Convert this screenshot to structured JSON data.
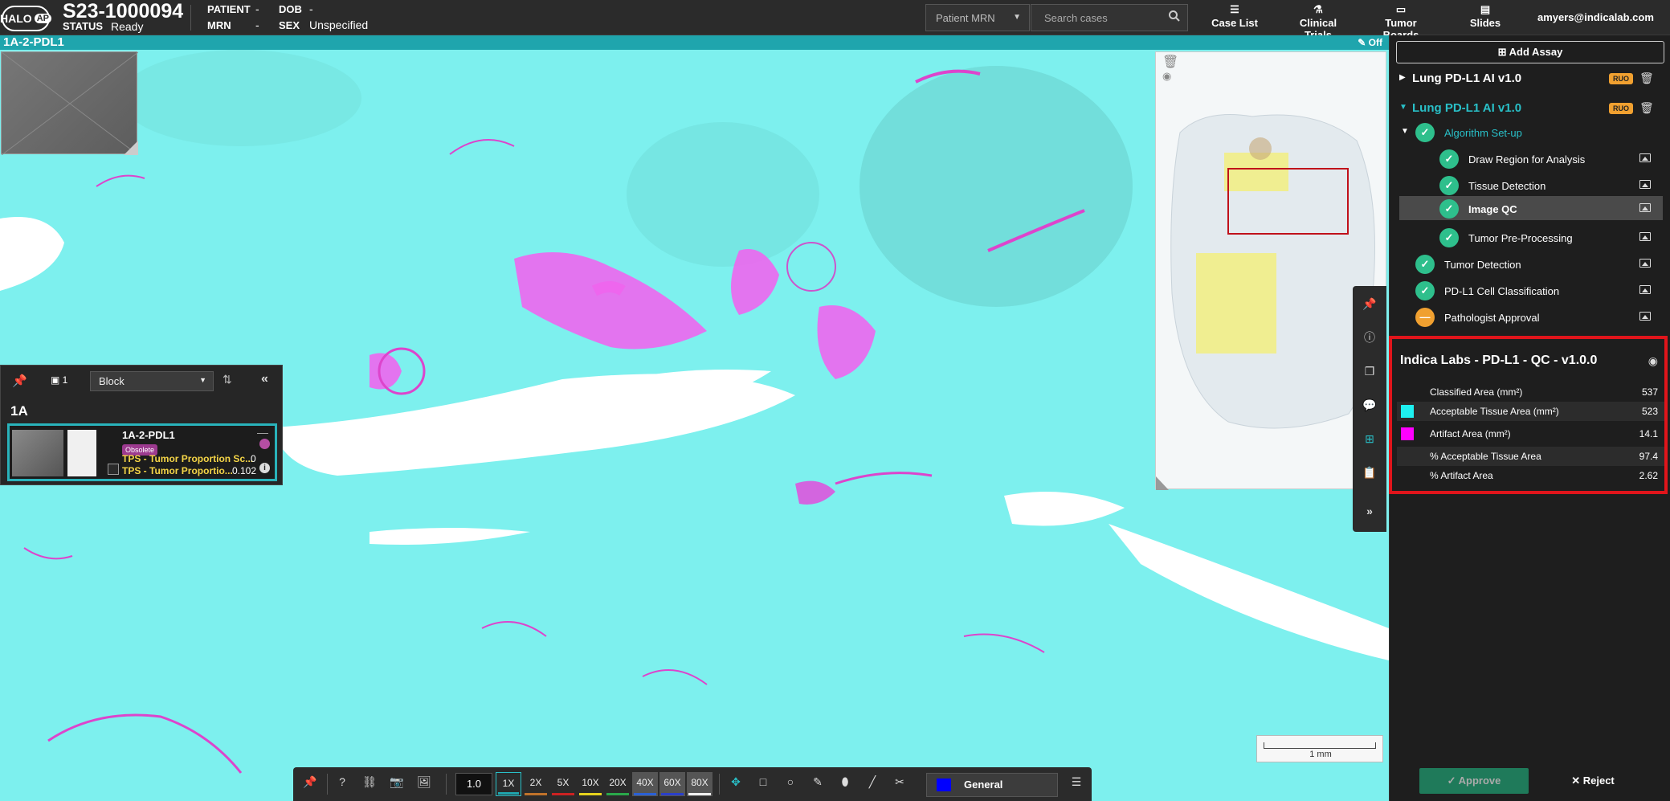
{
  "header": {
    "logo_text": "HALO",
    "logo_sub": "AP",
    "case_id": "S23-1000094",
    "status_label": "STATUS",
    "status_value": "Ready",
    "patient_label": "PATIENT",
    "patient_value": "-",
    "mrn_label": "MRN",
    "mrn_value": "-",
    "dob_label": "DOB",
    "dob_value": "-",
    "sex_label": "SEX",
    "sex_value": "Unspecified",
    "search_scope": "Patient MRN",
    "search_placeholder": "Search cases",
    "nav": [
      {
        "label": "Case List",
        "icon": "list-icon"
      },
      {
        "label": "Clinical Trials",
        "icon": "flask-icon"
      },
      {
        "label": "Tumor Boards",
        "icon": "board-icon"
      },
      {
        "label": "Slides",
        "icon": "slides-icon"
      }
    ],
    "user_email": "amyers@indicalab.com"
  },
  "viewer": {
    "slide_title": "1A-2-PDL1",
    "annotation_toggle": "Off",
    "scale_label": "1 mm"
  },
  "slide_panel": {
    "count": "1",
    "group_by": "Block",
    "group_name": "1A",
    "card": {
      "name": "1A-2-PDL1",
      "badge": "Obsolete",
      "tps1_label": "TPS - Tumor Proportion Sc...",
      "tps1_value": "0",
      "tps2_label": "TPS - Tumor Proportio...",
      "tps2_value": "0.102"
    }
  },
  "toolbar": {
    "zoom_value": "1.0",
    "zoom_levels": [
      {
        "label": "1X",
        "color": "#1fa5ad"
      },
      {
        "label": "2X",
        "color": "#c0722a"
      },
      {
        "label": "5X",
        "color": "#cc2222"
      },
      {
        "label": "10X",
        "color": "#e6d21e"
      },
      {
        "label": "20X",
        "color": "#2aa84a"
      },
      {
        "label": "40X",
        "color": "#2a60d6"
      },
      {
        "label": "60X",
        "color": "#2a3fc9"
      },
      {
        "label": "80X",
        "color": "#eeeeee"
      }
    ],
    "active_zoom": "1X",
    "layer_name": "General",
    "layer_color": "#0000ff"
  },
  "right_panel": {
    "add_assay_label": "Add Assay",
    "assays": [
      {
        "name": "Lung PD-L1 AI v1.0",
        "badge": "RUO",
        "expanded": false
      },
      {
        "name": "Lung PD-L1 AI v1.0",
        "badge": "RUO",
        "expanded": true
      }
    ],
    "algorithm_setup_label": "Algorithm Set-up",
    "substeps": [
      {
        "label": "Draw Region for Analysis",
        "selected": false
      },
      {
        "label": "Tissue Detection",
        "selected": false
      },
      {
        "label": "Image QC",
        "selected": true
      },
      {
        "label": "Tumor Pre-Processing",
        "selected": false
      }
    ],
    "steps": [
      {
        "label": "Tumor Detection",
        "state": "done"
      },
      {
        "label": "PD-L1 Cell Classification",
        "state": "done"
      },
      {
        "label": "Pathologist Approval",
        "state": "pending"
      }
    ],
    "qc": {
      "title": "Indica Labs - PD-L1 - QC - v1.0.0",
      "rows": [
        {
          "label": "Classified Area (mm²)",
          "value": "537",
          "swatch": ""
        },
        {
          "label": "Acceptable Tissue Area (mm²)",
          "value": "523",
          "swatch": "#1ef0f0"
        },
        {
          "label": "Artifact Area (mm²)",
          "value": "14.1",
          "swatch": "#ff00ff"
        },
        {
          "label": "% Acceptable Tissue Area",
          "value": "97.4",
          "swatch": ""
        },
        {
          "label": "% Artifact Area",
          "value": "2.62",
          "swatch": ""
        }
      ]
    },
    "approve_label": "Approve",
    "reject_label": "Reject"
  }
}
